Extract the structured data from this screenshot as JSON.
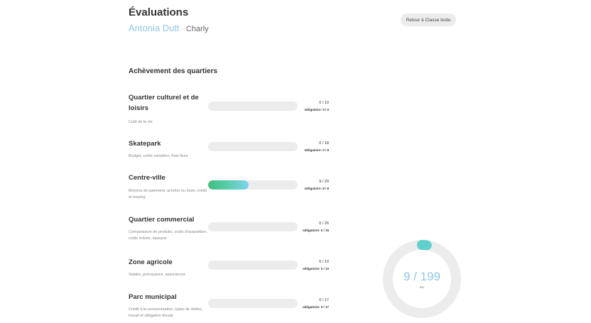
{
  "header": {
    "title": "Évaluations",
    "student_name": "Antonia Dutt",
    "separator": "·",
    "class_name": "Charly",
    "back_label": "Retour à Classe teste"
  },
  "section_title": "Achèvement des quartiers",
  "districts": [
    {
      "name": "Quartier culturel et de loisirs",
      "desc": "Coût de la vie",
      "score": "0 / 10",
      "required": "obligatoire: 0 / 0",
      "progress": 0
    },
    {
      "name": "Skatepark",
      "desc": "Budget, coûts variables, frais fixes",
      "score": "0 / 18",
      "required": "obligatoire: 0 / 8",
      "progress": 0
    },
    {
      "name": "Centre-ville",
      "desc": "Moyens de paiement, acheter ou louer, crédit et leasing",
      "score": "9 / 20",
      "required": "obligatoire: 8 / 8",
      "progress": 0.45
    },
    {
      "name": "Quartier commercial",
      "desc": "Comparaison de produits, coûts d'acquisition, coûts induits, épargne",
      "score": "0 / 26",
      "required": "obligatoire: 0 / 15",
      "progress": 0
    },
    {
      "name": "Zone agricole",
      "desc": "Salaire, prévoyance, assurances",
      "score": "0 / 10",
      "required": "obligatoire: 0 / 10",
      "progress": 0
    },
    {
      "name": "Parc municipal",
      "desc": "Crédit à la consommation, types de dettes, travail et obligation fiscale",
      "score": "0 / 17",
      "required": "obligatoire: 0 / 17",
      "progress": 0
    }
  ],
  "total": {
    "value": "9 / 199",
    "label": "Bei",
    "fraction": 0.045,
    "track_color": "#ececec",
    "fill_color": "#5ed1cc"
  },
  "colors": {
    "accent_name": "#8fc8e8",
    "bar_track": "#ececec",
    "bar_fill_start": "#3fbf7f",
    "bar_fill_end": "#7fd3f0"
  }
}
